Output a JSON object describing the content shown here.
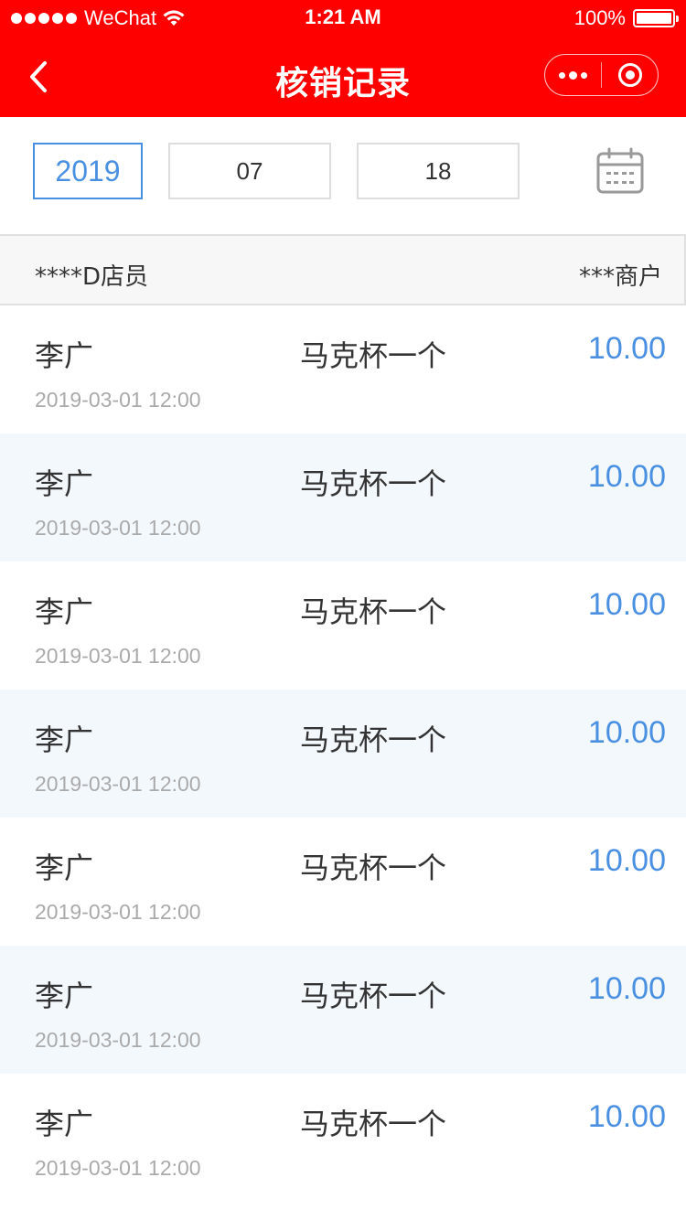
{
  "status_bar": {
    "carrier": "WeChat",
    "time": "1:21 AM",
    "battery": "100%",
    "battery_level": 1.0
  },
  "nav": {
    "title": "核销记录",
    "back_icon": "chevron-left-icon",
    "more_icon": "more-dots-icon",
    "close_icon": "target-icon"
  },
  "date_filter": {
    "year": "2019",
    "month": "07",
    "day": "18",
    "calendar_icon": "calendar-icon"
  },
  "table_header": {
    "left": "****D店员",
    "right": "***商户"
  },
  "records": [
    {
      "name": "李广",
      "item": "马克杯一个",
      "amount": "10.00",
      "time": "2019-03-01 12:00"
    },
    {
      "name": "李广",
      "item": "马克杯一个",
      "amount": "10.00",
      "time": "2019-03-01 12:00"
    },
    {
      "name": "李广",
      "item": "马克杯一个",
      "amount": "10.00",
      "time": "2019-03-01 12:00"
    },
    {
      "name": "李广",
      "item": "马克杯一个",
      "amount": "10.00",
      "time": "2019-03-01 12:00"
    },
    {
      "name": "李广",
      "item": "马克杯一个",
      "amount": "10.00",
      "time": "2019-03-01 12:00"
    },
    {
      "name": "李广",
      "item": "马克杯一个",
      "amount": "10.00",
      "time": "2019-03-01 12:00"
    },
    {
      "name": "李广",
      "item": "马克杯一个",
      "amount": "10.00",
      "time": "2019-03-01 12:00"
    }
  ],
  "colors": {
    "brand_red": "#ff0000",
    "accent_blue": "#4a90e2",
    "alt_row": "#f3f8fd"
  }
}
